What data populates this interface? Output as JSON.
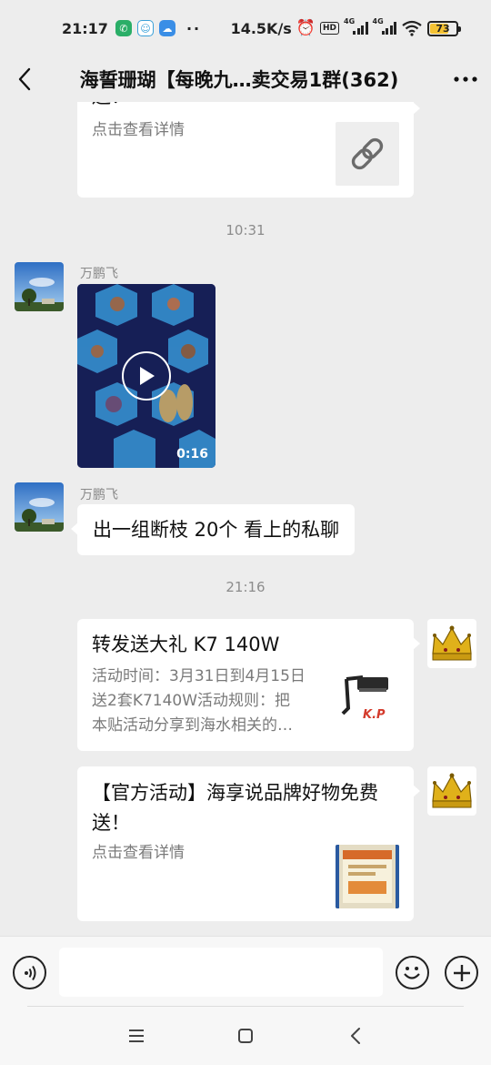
{
  "status_bar": {
    "time": "21:17",
    "dots": "··",
    "net_speed": "14.5K/s",
    "hd": "HD",
    "sim1": "4G",
    "sim2": "4G",
    "battery": "73",
    "battery_level": 0.73
  },
  "header": {
    "title": "海誓珊瑚【每晚九…卖交易1群(362)"
  },
  "messages": {
    "card_top": {
      "title_tail": "送！",
      "desc": "点击查看详情"
    },
    "time1": "10:31",
    "video_msg": {
      "sender": "万鹏飞",
      "duration": "0:16"
    },
    "text_msg": {
      "sender": "万鹏飞",
      "text": "出一组断枝 20个 看上的私聊"
    },
    "time2": "21:16",
    "card_k7": {
      "title": "转发送大礼 K7 140W",
      "desc1": "活动时间：3月31日到4月15日",
      "desc2": "送2套K7140W活动规则：把",
      "desc3": "本贴活动分享到海水相关的…",
      "thumb_caption": "K.P"
    },
    "card_official": {
      "title1": "【官方活动】海享说品牌好物免费",
      "title2": "送！",
      "desc": "点击查看详情"
    }
  },
  "colors": {
    "background": "#ededed",
    "bubble": "#ffffff",
    "muted_text": "#8c8c8c",
    "battery": "#f4c233"
  }
}
